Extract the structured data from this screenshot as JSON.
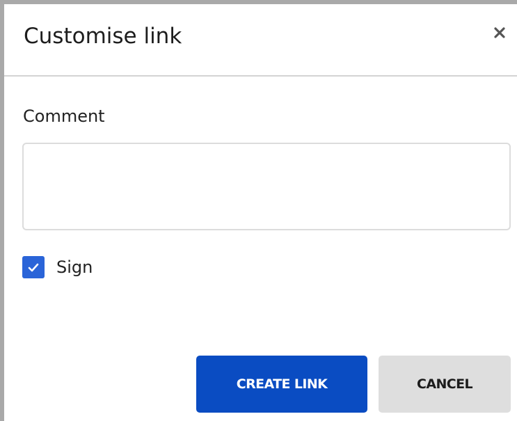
{
  "dialog": {
    "title": "Customise link",
    "close_icon": "close-icon"
  },
  "form": {
    "comment_label": "Comment",
    "comment_value": "",
    "comment_placeholder": "",
    "sign_label": "Sign",
    "sign_checked": true,
    "checkbox_icon": "checkmark-icon"
  },
  "actions": {
    "create_label": "CREATE LINK",
    "cancel_label": "CANCEL"
  },
  "colors": {
    "primary": "#0a4cc2",
    "checkbox": "#2a64d8",
    "secondary_bg": "#dedede",
    "border": "#dcdcdc"
  }
}
